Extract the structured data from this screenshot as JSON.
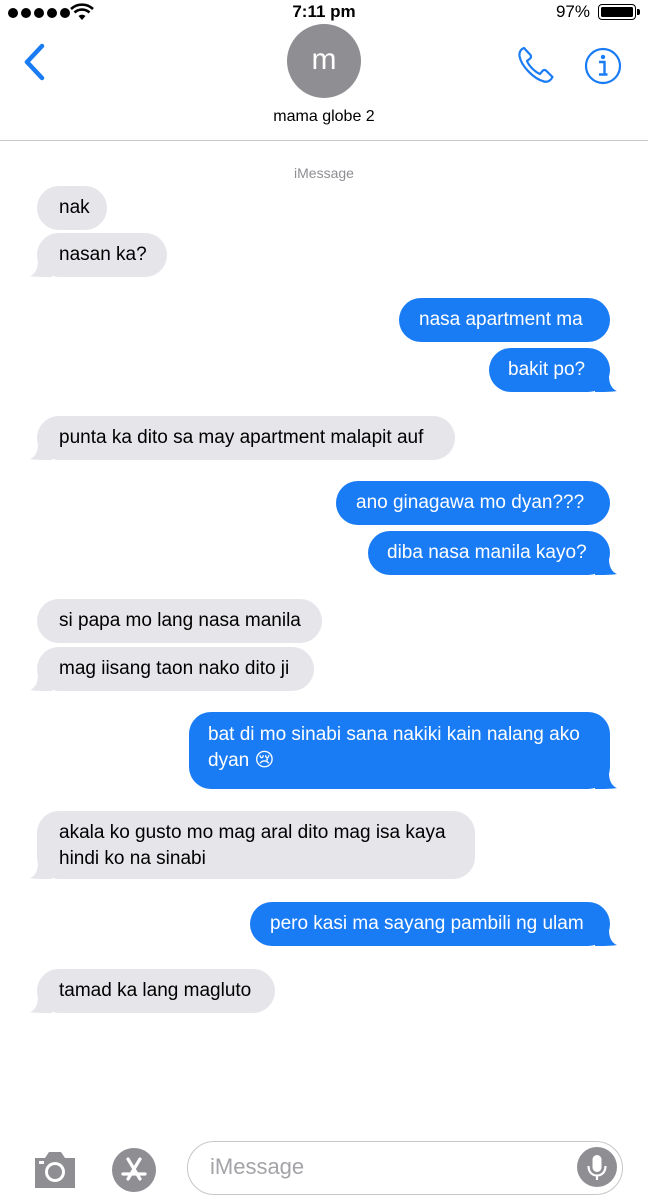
{
  "status_bar": {
    "time": "7:11 pm",
    "battery_percent": "97%",
    "signal_bars": 5
  },
  "header": {
    "back_icon": "chevron-left-icon",
    "avatar_initial": "m",
    "contact_name": "mama globe 2",
    "phone_icon": "phone-icon",
    "info_icon": "info-icon",
    "accent_color": "#1a7cf5"
  },
  "service_label": "iMessage",
  "messages": [
    {
      "dir": "in",
      "text": "nak"
    },
    {
      "dir": "in",
      "text": "nasan ka?"
    },
    {
      "dir": "out",
      "text": "nasa apartment ma"
    },
    {
      "dir": "out",
      "text": "bakit po?"
    },
    {
      "dir": "in",
      "text": "punta ka dito sa may apartment malapit auf"
    },
    {
      "dir": "out",
      "text": "ano ginagawa mo dyan???"
    },
    {
      "dir": "out",
      "text": "diba nasa manila kayo?"
    },
    {
      "dir": "in",
      "text": "si papa mo lang nasa manila"
    },
    {
      "dir": "in",
      "text": "mag iisang taon nako dito ji"
    },
    {
      "dir": "out",
      "text": "bat di mo sinabi sana nakiki kain nalang ako dyan 😢"
    },
    {
      "dir": "in",
      "text": "akala ko gusto mo mag aral dito mag isa kaya hindi ko na sinabi"
    },
    {
      "dir": "out",
      "text": "pero kasi ma sayang pambili ng ulam"
    },
    {
      "dir": "in",
      "text": "tamad ka lang magluto"
    }
  ],
  "composer": {
    "placeholder": "iMessage",
    "camera_icon": "camera-icon",
    "appstore_icon": "app-store-icon",
    "mic_icon": "microphone-icon"
  }
}
